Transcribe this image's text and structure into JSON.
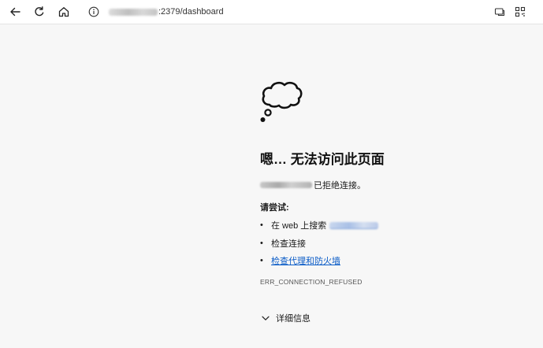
{
  "toolbar": {
    "url_suffix": ":2379/dashboard"
  },
  "error": {
    "title": "嗯… 无法访问此页面",
    "refused_suffix": "已拒绝连接。",
    "try_label": "请尝试:",
    "suggestions": {
      "search_prefix": "在 web 上搜索",
      "check_connection": "检查连接",
      "check_proxy_firewall": "检查代理和防火墙"
    },
    "code": "ERR_CONNECTION_REFUSED",
    "details_label": "详细信息"
  },
  "colors": {
    "link": "#0b5cc7",
    "background": "#f7f7f7"
  },
  "icons": [
    "back-arrow-icon",
    "refresh-icon",
    "home-icon",
    "info-icon",
    "reading-view-icon",
    "qr-code-icon",
    "thought-cloud-icon",
    "chevron-down-icon"
  ]
}
